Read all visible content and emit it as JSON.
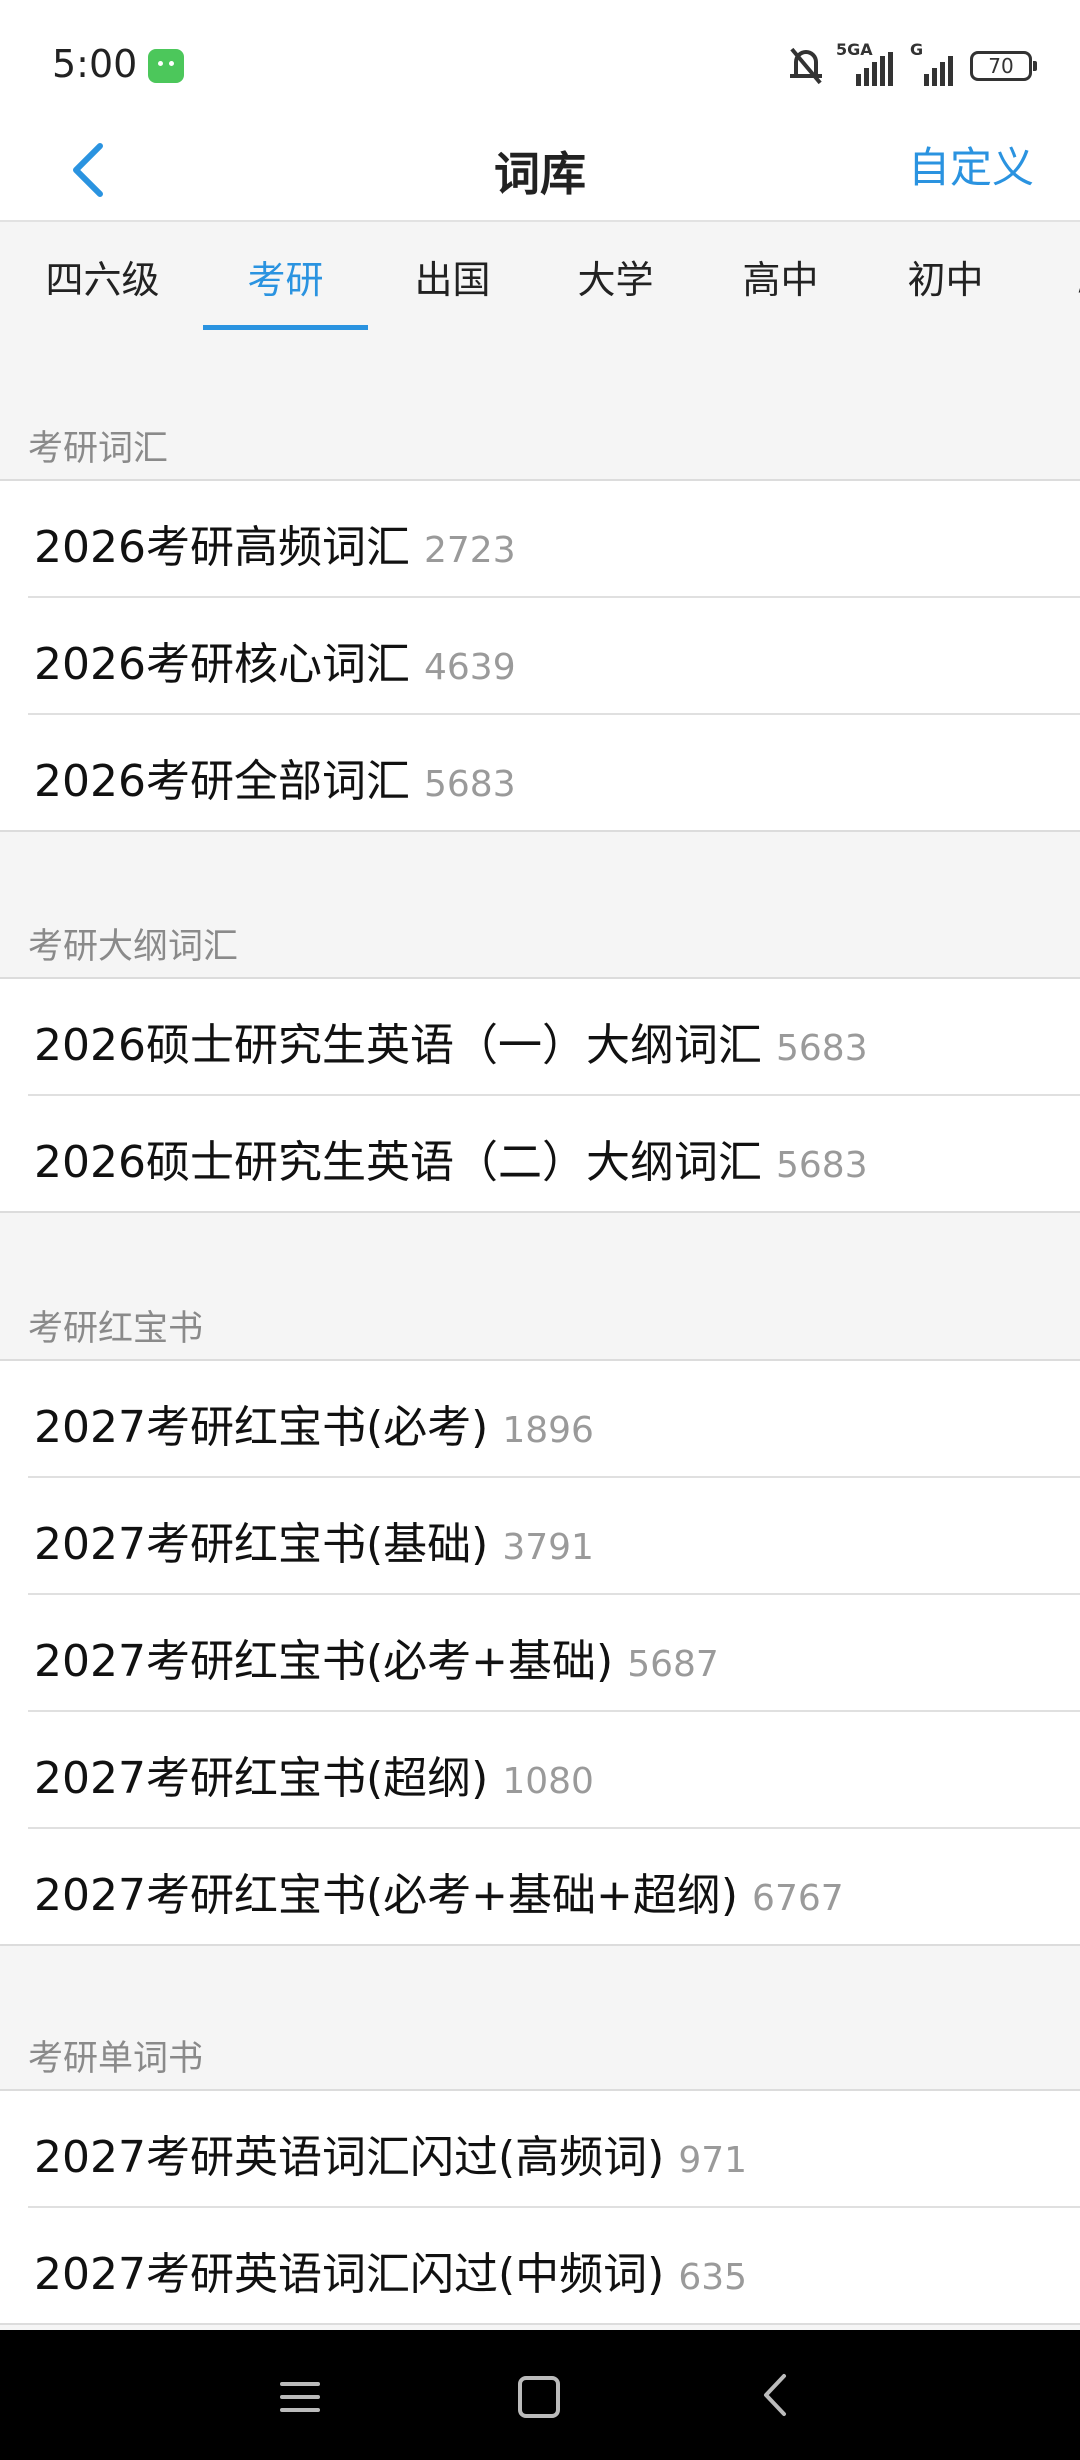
{
  "status_bar": {
    "time": "5:00",
    "network_1": "5GA",
    "network_2": "G",
    "battery": "70"
  },
  "header": {
    "title": "词库",
    "action": "自定义"
  },
  "tabs": [
    {
      "label": "四六级",
      "active": false
    },
    {
      "label": "考研",
      "active": true
    },
    {
      "label": "出国",
      "active": false
    },
    {
      "label": "大学",
      "active": false
    },
    {
      "label": "高中",
      "active": false
    },
    {
      "label": "初中",
      "active": false
    }
  ],
  "sections": [
    {
      "title": "考研词汇",
      "items": [
        {
          "name": "2026考研高频词汇",
          "count": "2723"
        },
        {
          "name": "2026考研核心词汇",
          "count": "4639"
        },
        {
          "name": "2026考研全部词汇",
          "count": "5683"
        }
      ]
    },
    {
      "title": "考研大纲词汇",
      "items": [
        {
          "name": "2026硕士研究生英语（一）大纲词汇",
          "count": "5683"
        },
        {
          "name": "2026硕士研究生英语（二）大纲词汇",
          "count": "5683"
        }
      ]
    },
    {
      "title": "考研红宝书",
      "items": [
        {
          "name": "2027考研红宝书(必考)",
          "count": "1896"
        },
        {
          "name": "2027考研红宝书(基础)",
          "count": "3791"
        },
        {
          "name": "2027考研红宝书(必考+基础)",
          "count": "5687"
        },
        {
          "name": "2027考研红宝书(超纲)",
          "count": "1080"
        },
        {
          "name": "2027考研红宝书(必考+基础+超纲)",
          "count": "6767"
        }
      ]
    },
    {
      "title": "考研单词书",
      "items": [
        {
          "name": "2027考研英语词汇闪过(高频词)",
          "count": "971"
        },
        {
          "name": "2027考研英语词汇闪过(中频词)",
          "count": "635"
        }
      ]
    }
  ],
  "colors": {
    "accent": "#2a93e0",
    "background": "#f5f5f5",
    "count_text": "#9a9a9a",
    "section_title": "#8a8a8a"
  }
}
